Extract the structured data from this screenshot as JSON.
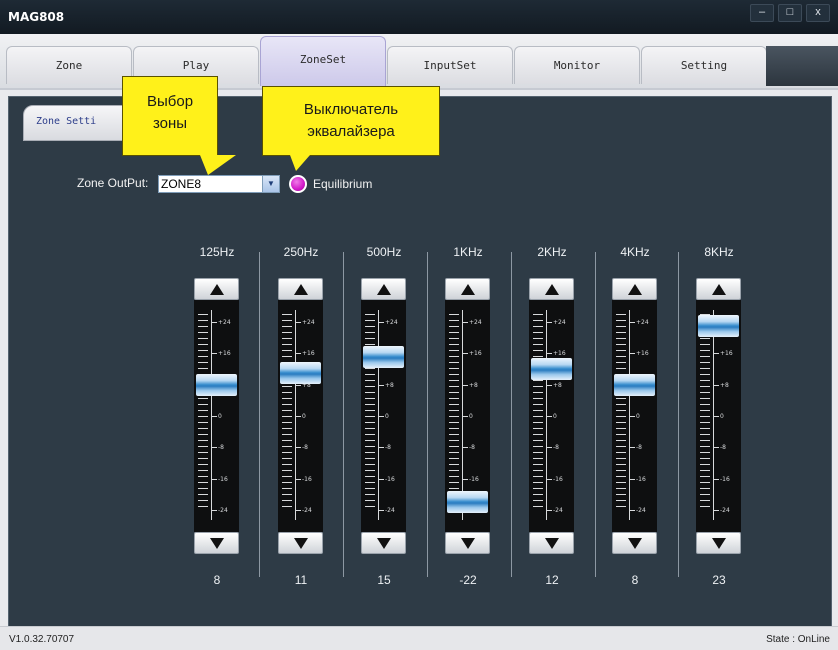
{
  "window": {
    "title": "MAG808",
    "minimize": "–",
    "maximize": "□",
    "close": "x"
  },
  "tabs": [
    {
      "label": "Zone"
    },
    {
      "label": "Play"
    },
    {
      "label": "ZoneSet"
    },
    {
      "label": "InputSet"
    },
    {
      "label": "Monitor"
    },
    {
      "label": "Setting"
    }
  ],
  "active_tab": "ZoneSet",
  "subtab": {
    "label": "Zone Setti"
  },
  "zone": {
    "label": "Zone OutPut:",
    "value": "ZONE8",
    "arrow": "▼"
  },
  "equilibrium": {
    "label": "Equilibrium"
  },
  "annotations": [
    {
      "text_line1": "Выбор",
      "text_line2": "зоны"
    },
    {
      "text_line1": "Выключатель",
      "text_line2": "эквалайзера"
    }
  ],
  "eq": {
    "range": [
      -26,
      26
    ],
    "scale_labels": [
      "+24",
      "+16",
      "+8",
      "0",
      "-8",
      "-16",
      "-24"
    ],
    "bands": [
      {
        "freq": "125Hz",
        "value": 8
      },
      {
        "freq": "250Hz",
        "value": 11
      },
      {
        "freq": "500Hz",
        "value": 15
      },
      {
        "freq": "1KHz",
        "value": -22
      },
      {
        "freq": "2KHz",
        "value": 12
      },
      {
        "freq": "4KHz",
        "value": 8
      },
      {
        "freq": "8KHz",
        "value": 23
      }
    ]
  },
  "status": {
    "version": "V1.0.32.70707",
    "state": "State : OnLine"
  },
  "colors": {
    "panel": "#2e3b46",
    "callout": "#fff11a",
    "toggle": "#d219c9",
    "handle": "#2a7cc0"
  }
}
